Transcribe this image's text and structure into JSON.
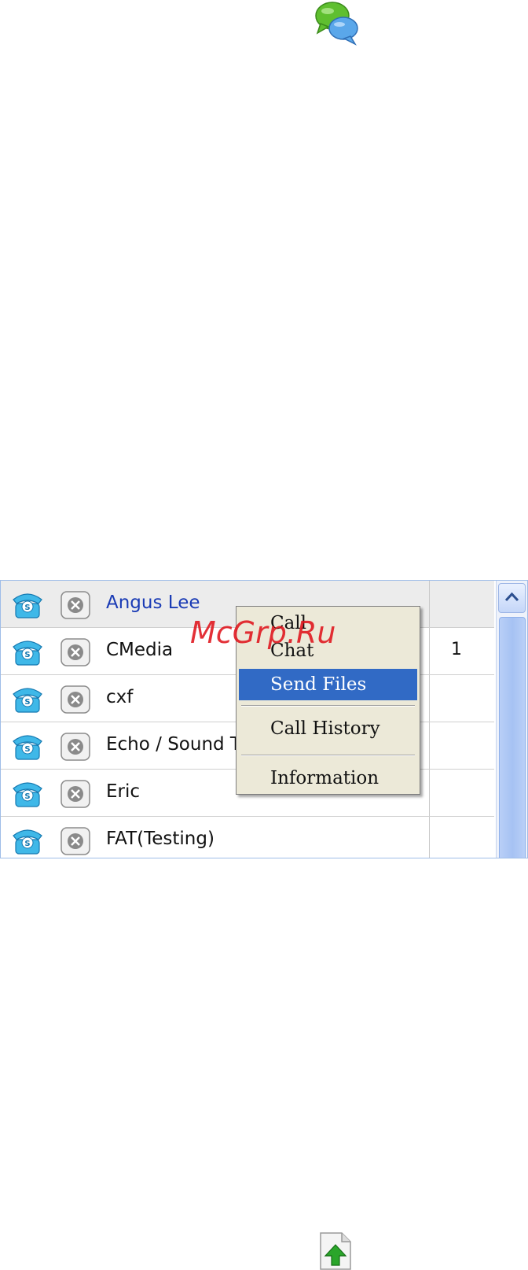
{
  "watermark": "McGrp.Ru",
  "contacts": [
    {
      "name": "Angus Lee",
      "count": ""
    },
    {
      "name": "CMedia",
      "count": "1"
    },
    {
      "name": "cxf",
      "count": ""
    },
    {
      "name": "Echo / Sound T",
      "count": ""
    },
    {
      "name": "Eric",
      "count": ""
    },
    {
      "name": "FAT(Testing)",
      "count": ""
    }
  ],
  "context_menu": {
    "call": "Call",
    "chat": "Chat",
    "send_files": "Send Files",
    "call_history": "Call History",
    "information": "Information"
  },
  "colors": {
    "selected_name": "#1a3bb5",
    "menu_highlight": "#316ac5",
    "watermark": "#e0141c"
  }
}
